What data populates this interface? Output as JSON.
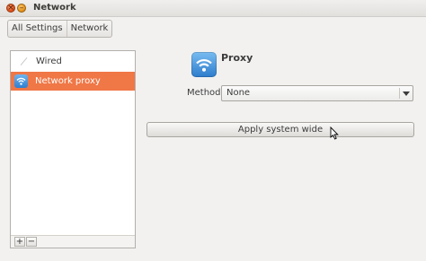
{
  "window": {
    "title": "Network"
  },
  "breadcrumb": {
    "items": [
      "All Settings",
      "Network"
    ]
  },
  "sidebar": {
    "items": [
      {
        "label": "Wired",
        "icon": "wired-icon",
        "selected": false
      },
      {
        "label": "Network proxy",
        "icon": "network-proxy-icon",
        "selected": true
      }
    ],
    "add_label": "+",
    "remove_label": "−"
  },
  "main": {
    "title": "Proxy",
    "icon": "network-proxy-icon",
    "method_label": "Method",
    "method_value": "None",
    "apply_label": "Apply system wide"
  },
  "colors": {
    "selection": "#f07746",
    "window_bg": "#f2f1f0",
    "close_button": "#e0501e",
    "min_button": "#e8941c"
  }
}
